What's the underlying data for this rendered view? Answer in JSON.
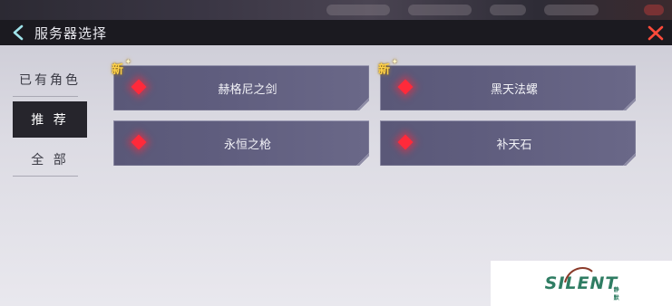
{
  "window": {
    "title": "服务器选择"
  },
  "icons": {
    "back": "chevron-left-icon",
    "close": "close-icon",
    "server_marker": "diamond-gem-icon"
  },
  "colors": {
    "accent_close": "#ff4a3a",
    "gem": "#ff2a3a",
    "new_badge": "#ffd24a",
    "active_tab_bg": "#26252c"
  },
  "sidebar": {
    "tabs": [
      {
        "label": "已有角色",
        "active": false
      },
      {
        "label": "推 荐",
        "active": true
      },
      {
        "label": "全 部",
        "active": false
      }
    ]
  },
  "servers": [
    {
      "name": "赫格尼之剑",
      "badge": "新"
    },
    {
      "name": "黑天法螺",
      "badge": "新"
    },
    {
      "name": "永恒之枪",
      "badge": ""
    },
    {
      "name": "补天石",
      "badge": ""
    }
  ],
  "watermark": {
    "text": "SILENT",
    "sub": "静默"
  }
}
